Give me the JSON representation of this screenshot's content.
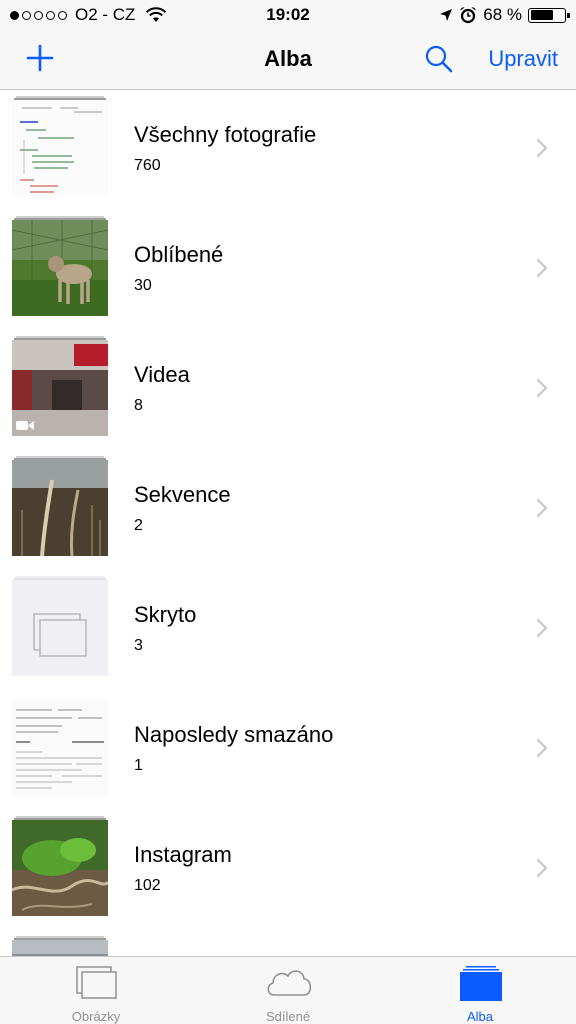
{
  "status_bar": {
    "signal_dots_filled": 1,
    "signal_dots_total": 5,
    "carrier": "O2 - CZ",
    "time": "19:02",
    "battery_percent": "68 %",
    "battery_level": 0.68,
    "icons": [
      "wifi-icon",
      "location-arrow-icon",
      "alarm-clock-icon",
      "battery-icon"
    ]
  },
  "nav": {
    "title": "Alba",
    "edit_label": "Upravit",
    "left_icon": "plus-icon",
    "right_icon": "search-icon"
  },
  "albums": [
    {
      "name": "Všechny fotografie",
      "count": "760",
      "thumb": "handwritten-notes"
    },
    {
      "name": "Oblíbené",
      "count": "30",
      "thumb": "dog-photo"
    },
    {
      "name": "Videa",
      "count": "8",
      "thumb": "store-interior-video"
    },
    {
      "name": "Sekvence",
      "count": "2",
      "thumb": "dry-plants"
    },
    {
      "name": "Skryto",
      "count": "3",
      "thumb": "hidden-placeholder"
    },
    {
      "name": "Naposledy smazáno",
      "count": "1",
      "thumb": "receipt"
    },
    {
      "name": "Instagram",
      "count": "102",
      "thumb": "green-plant"
    }
  ],
  "tabs": [
    {
      "label": "Obrázky",
      "icon": "photos-stack-icon",
      "active": false
    },
    {
      "label": "Sdílené",
      "icon": "cloud-icon",
      "active": false
    },
    {
      "label": "Alba",
      "icon": "albums-icon",
      "active": true
    }
  ],
  "colors": {
    "accent": "#0a5cff",
    "bar_background": "#f7f7f7",
    "separator": "#c8c7cc",
    "chevron": "#c7c7cc",
    "inactive_tab": "#929292"
  }
}
